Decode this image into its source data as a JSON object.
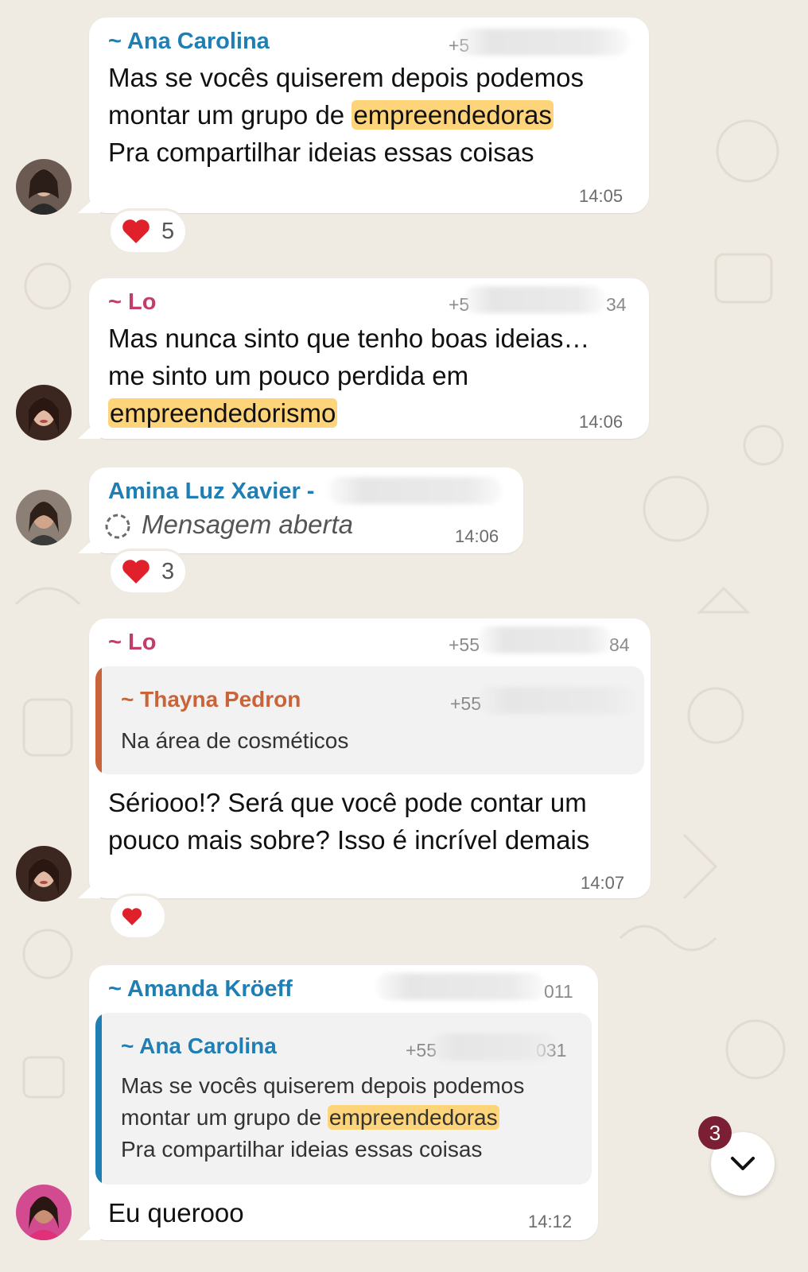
{
  "colors": {
    "background": "#efeae2",
    "bubble": "#ffffff",
    "highlight": "#fdd47a",
    "name_blue": "#1f7fb5",
    "name_pink": "#c13e6b",
    "name_orange": "#c9643a",
    "badge": "#7a1f34",
    "heart": "#e0202b"
  },
  "messages": [
    {
      "sender": "~ Ana Carolina",
      "phone": "+5",
      "lines": [
        [
          "Mas se vocês quiserem depois podemos"
        ],
        [
          "montar um grupo de ",
          "empreendedoras"
        ],
        [
          "Pra compartilhar ideias essas coisas"
        ]
      ],
      "time": "14:05",
      "reaction": {
        "emoji": "heart-icon",
        "count": "5"
      }
    },
    {
      "sender": "~ Lo",
      "phone": "+5",
      "phone_tail": "34",
      "lines": [
        [
          "Mas nunca sinto que tenho boas ideias…"
        ],
        [
          "me sinto um pouco perdida em"
        ],
        [
          "empreendedorismo"
        ]
      ],
      "time": "14:06"
    },
    {
      "sender": "Amina Luz Xavier - ",
      "status_text": "Mensagem aberta",
      "time": "14:06",
      "reaction": {
        "emoji": "heart-icon",
        "count": "3"
      }
    },
    {
      "sender": "~ Lo",
      "phone": "+55",
      "phone_tail": "84",
      "quote": {
        "sender": "~ Thayna Pedron",
        "phone": "+55",
        "text": "Na área de cosméticos"
      },
      "lines": [
        [
          "Sériooo!? Será que você pode contar um"
        ],
        [
          "pouco mais sobre? Isso é incrível demais"
        ]
      ],
      "time": "14:07",
      "reaction": {
        "emoji": "heart-icon",
        "count": ""
      }
    },
    {
      "sender": "~ Amanda Kröeff",
      "phone_tail": "011",
      "quote": {
        "sender": "~ Ana Carolina",
        "phone": "+55",
        "phone_tail": "031",
        "lines": [
          [
            "Mas se vocês quiserem depois podemos"
          ],
          [
            "montar um grupo de ",
            "empreendedoras"
          ],
          [
            "Pra compartilhar ideias essas coisas"
          ]
        ]
      },
      "lines": [
        [
          "Eu querooo"
        ]
      ],
      "time": "14:12"
    }
  ],
  "scroll_button": {
    "icon": "chevron-down-icon",
    "unread_count": "3"
  }
}
